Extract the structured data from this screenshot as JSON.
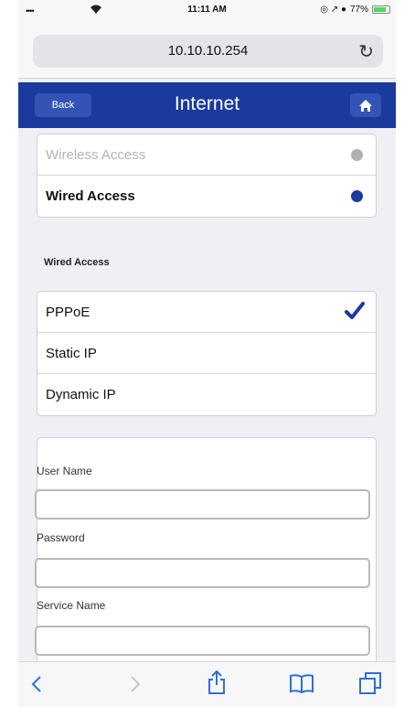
{
  "status_bar": {
    "signal": "••••",
    "time": "11:11 AM",
    "indicators": "◎ ↗ ●",
    "battery_percent": "77%",
    "battery_level": 0.77
  },
  "address_bar": {
    "url": "10.10.10.254",
    "reload_icon": "↻"
  },
  "nav": {
    "back_label": "Back",
    "title": "Internet"
  },
  "access_options": [
    {
      "label": "Wireless Access",
      "selected": false
    },
    {
      "label": "Wired Access",
      "selected": true
    }
  ],
  "section_label": "Wired Access",
  "connection_types": [
    {
      "label": "PPPoE",
      "checked": true
    },
    {
      "label": "Static IP",
      "checked": false
    },
    {
      "label": "Dynamic IP",
      "checked": false
    }
  ],
  "form": {
    "user_name_label": "User Name",
    "user_name_value": "",
    "password_label": "Password",
    "password_value": "",
    "service_name_label": "Service Name",
    "service_name_value": ""
  },
  "colors": {
    "nav_blue": "#1b3a9e",
    "selected_dot": "#1b3a9e",
    "unselected_dot": "#b0b0b4",
    "check": "#1b3a9e",
    "toolbar_icon": "#2f6fd6"
  },
  "toolbar_icons": [
    "back-icon",
    "forward-icon",
    "share-icon",
    "bookmarks-icon",
    "tabs-icon"
  ]
}
